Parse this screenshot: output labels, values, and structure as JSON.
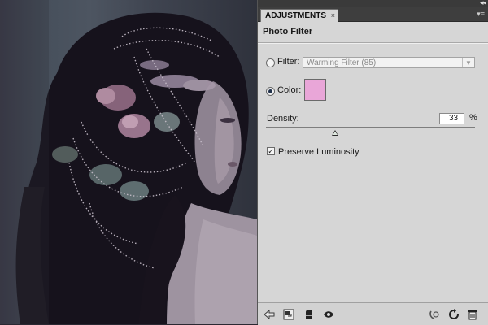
{
  "panel": {
    "tab_label": "ADJUSTMENTS",
    "tab_close": "×",
    "collapse_glyph": "◂◂",
    "menu_glyph": "▾≡",
    "title": "Photo Filter"
  },
  "filter": {
    "label": "Filter:",
    "selected": false,
    "value": "Warming Filter (85)"
  },
  "color": {
    "label": "Color:",
    "selected": true,
    "swatch": "#e9a6d8"
  },
  "density": {
    "label": "Density:",
    "value": "33",
    "unit": "%",
    "level": 33
  },
  "preserve": {
    "checked": true,
    "mark": "✓",
    "label": "Preserve Luminosity"
  },
  "bottom_icons": [
    "back-arrow-icon",
    "clip-to-layer-icon",
    "visibility-mask-icon",
    "eye-icon",
    "view-previous-icon",
    "reset-icon",
    "delete-icon"
  ],
  "colors": {
    "panel_bg": "#d6d6d6",
    "dark_bar": "#3e3e3e",
    "accent": "#20304a"
  }
}
